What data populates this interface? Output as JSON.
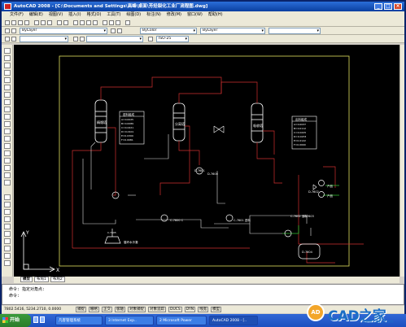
{
  "window": {
    "title": "AutoCAD 2008 - [C:\\Documents and Settings\\高峰\\桌面\\芳烃裂化工业厂流程图.dwg]"
  },
  "menubar": [
    "文件(F)",
    "编辑(E)",
    "视图(V)",
    "插入(I)",
    "格式(O)",
    "工具(T)",
    "绘图(D)",
    "标注(N)",
    "修改(M)",
    "窗口(W)",
    "帮助(H)"
  ],
  "toolbar": {
    "layer_combo": "ByLayer",
    "color_combo": "ByColor",
    "linetype_combo": "ByLayer",
    "style_combo": "ISO-25"
  },
  "drawing": {
    "tower_labels": [
      "精馏塔",
      "分离塔",
      "吸收塔"
    ],
    "table1_title": "进料组成",
    "table1_rows": [
      "A=0.0025",
      "B=0.0089",
      "C=0.0221",
      "D=0.0101",
      "E=0.0300",
      "F=0.0081"
    ],
    "table2_title": "出料组成",
    "table2_rows": [
      "A=0.0037",
      "B=0.0112",
      "C=0.0245",
      "D=0.0233",
      "E=0.0122",
      "F=0.0090"
    ],
    "pump_labels": [
      "C-7600 C",
      "C-7601 进料",
      "C-7602 出料"
    ],
    "valve_labels": [
      "D-7600",
      "D-7601",
      "D-7602",
      "D-7603"
    ],
    "label_bottom": "循环水冷凝",
    "label_right": [
      "产品",
      "产品"
    ],
    "tank_label": "D-7604",
    "compressor_label": "C-7605"
  },
  "tabs": [
    "模型",
    "布局1",
    "布局2"
  ],
  "command": {
    "line1": "命令: 指定对角点:",
    "line2": "命令:"
  },
  "status": {
    "coords": "7802.5416, 5234.2710, 0.0000",
    "buttons": [
      "捕捉",
      "栅格",
      "正交",
      "极轴",
      "对象捕捉",
      "对象追踪",
      "DUCS",
      "DYN",
      "线宽",
      "模型"
    ]
  },
  "taskbar": {
    "start": "开始",
    "tasks": [
      "凡客管理系统",
      "3 Internet Exp..",
      "2 Microsoft Power",
      "AutoCAD 2008 - [..",
      ""
    ],
    "clock": "14:32"
  },
  "watermark": {
    "text": "CAD之家",
    "url": "www.cadzj.com"
  },
  "colors": {
    "canvas": "#000000",
    "line_white": "#ffffff",
    "line_red": "#d03030",
    "frame_yellow": "#e0e060",
    "stream_green": "#30c030"
  }
}
